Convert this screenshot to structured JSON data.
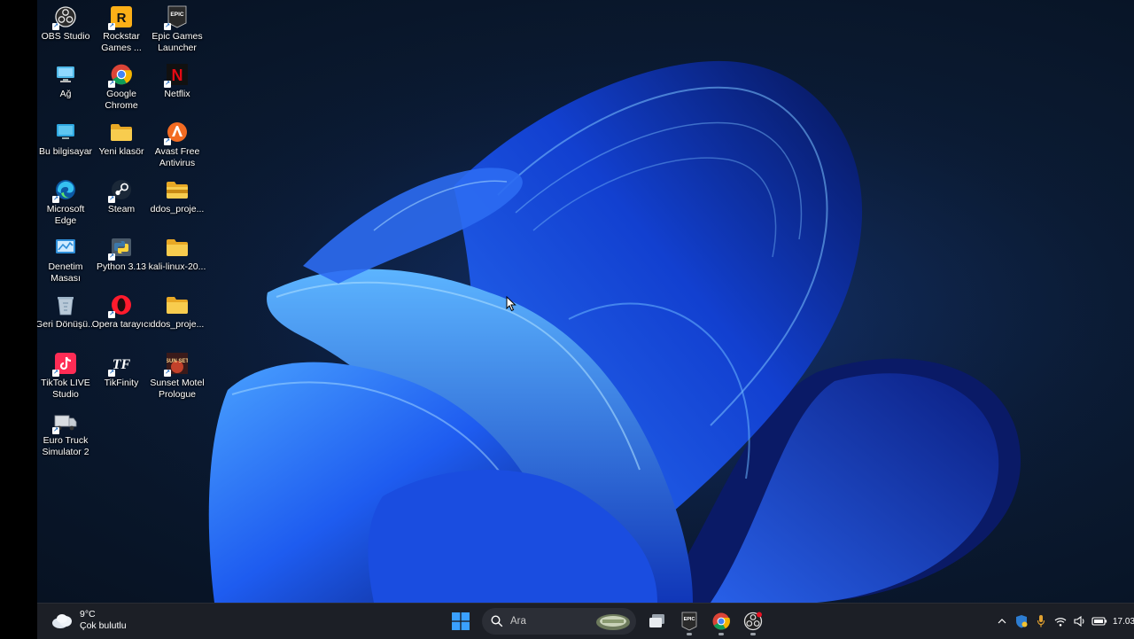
{
  "desktop": {
    "icons": [
      {
        "label": "OBS Studio",
        "icon": "obs-icon"
      },
      {
        "label": "Rockstar Games ...",
        "icon": "rockstar-icon"
      },
      {
        "label": "Epic Games Launcher",
        "icon": "epic-games-icon"
      },
      {
        "label": "Ağ",
        "icon": "network-icon"
      },
      {
        "label": "Google Chrome",
        "icon": "chrome-icon"
      },
      {
        "label": "Netflix",
        "icon": "netflix-icon"
      },
      {
        "label": "Bu bilgisayar",
        "icon": "computer-icon"
      },
      {
        "label": "Yeni klasör",
        "icon": "folder-icon"
      },
      {
        "label": "Avast Free Antivirus",
        "icon": "avast-icon"
      },
      {
        "label": "Microsoft Edge",
        "icon": "edge-icon"
      },
      {
        "label": "Steam",
        "icon": "steam-icon"
      },
      {
        "label": "ddos_proje...",
        "icon": "zip-folder-icon"
      },
      {
        "label": "Denetim Masası",
        "icon": "control-panel-icon"
      },
      {
        "label": "Python 3.13",
        "icon": "python-icon"
      },
      {
        "label": "kali-linux-20...",
        "icon": "folder-icon"
      },
      {
        "label": "Geri Dönüşü...",
        "icon": "recycle-bin-icon"
      },
      {
        "label": "Opera tarayıcı",
        "icon": "opera-icon"
      },
      {
        "label": "ddos_proje...",
        "icon": "folder-icon"
      },
      {
        "label": "TikTok LIVE Studio",
        "icon": "tiktok-icon"
      },
      {
        "label": "TikFinity",
        "icon": "tikfinity-icon"
      },
      {
        "label": "Sunset Motel Prologue",
        "icon": "sunset-motel-icon"
      },
      {
        "label": "Euro Truck Simulator 2",
        "icon": "euro-truck-icon"
      }
    ],
    "epic_logo_text": "EPIC",
    "netflix_logo_text": "N",
    "rockstar_logo_text": "R",
    "tikfinity_logo_text": "TF",
    "sunset_logo_text": "SUN SET"
  },
  "taskbar": {
    "weather": {
      "temp": "9°C",
      "condition": "Çok bulutlu",
      "icon": "cloudy-icon"
    },
    "search": {
      "placeholder": "Ara"
    },
    "pinned": [
      {
        "name": "windows-start",
        "icon": "windows-logo-icon"
      },
      {
        "name": "task-view",
        "icon": "task-view-icon"
      },
      {
        "name": "epic-games",
        "icon": "epic-games-icon",
        "running": true
      },
      {
        "name": "google-chrome",
        "icon": "chrome-icon",
        "running": true
      },
      {
        "name": "obs-studio",
        "icon": "obs-icon",
        "running": true
      }
    ],
    "epic_text": "EPIC",
    "tray": {
      "icons": [
        "chevron-up-icon",
        "defender-icon",
        "microphone-icon",
        "wifi-icon",
        "speaker-icon",
        "battery-icon"
      ],
      "time": "17.03"
    },
    "colors": {
      "accent": "#0f6cbd",
      "taskbar_bg": "#1c1f26"
    }
  }
}
